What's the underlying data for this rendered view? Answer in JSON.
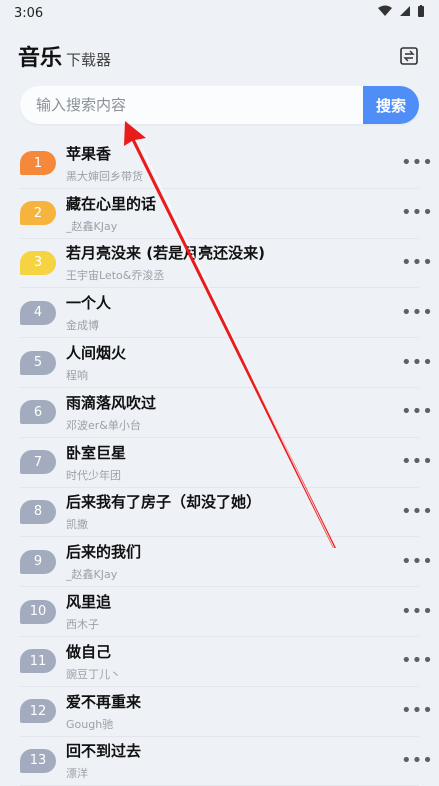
{
  "status": {
    "time": "3:06"
  },
  "header": {
    "title_main": "音乐",
    "title_sub": "下载器"
  },
  "search": {
    "placeholder": "输入搜索内容",
    "button_label": "搜索"
  },
  "songs": [
    {
      "rank": "1",
      "title": "苹果香",
      "artist": "黑大婶回乡带货",
      "badge_color": "#f6883c"
    },
    {
      "rank": "2",
      "title": "藏在心里的话",
      "artist": "_赵鑫KJay",
      "badge_color": "#f6b43f"
    },
    {
      "rank": "3",
      "title": "若月亮没来 (若是月亮还没来)",
      "artist": "王宇宙Leto&乔浚丞",
      "badge_color": "#f5d341"
    },
    {
      "rank": "4",
      "title": "一个人",
      "artist": "金成博",
      "badge_color": "#a2acbe"
    },
    {
      "rank": "5",
      "title": "人间烟火",
      "artist": "程响",
      "badge_color": "#a2acbe"
    },
    {
      "rank": "6",
      "title": "雨滴落风吹过",
      "artist": "邓波er&单小台",
      "badge_color": "#a2acbe"
    },
    {
      "rank": "7",
      "title": "卧室巨星",
      "artist": "时代少年团",
      "badge_color": "#a2acbe"
    },
    {
      "rank": "8",
      "title": "后来我有了房子（却没了她）",
      "artist": "凯撒",
      "badge_color": "#a2acbe"
    },
    {
      "rank": "9",
      "title": "后来的我们",
      "artist": "_赵鑫KJay",
      "badge_color": "#a2acbe"
    },
    {
      "rank": "10",
      "title": "风里追",
      "artist": "西木子",
      "badge_color": "#a2acbe"
    },
    {
      "rank": "11",
      "title": "做自己",
      "artist": "豌豆丁儿丶",
      "badge_color": "#a2acbe"
    },
    {
      "rank": "12",
      "title": "爱不再重来",
      "artist": "Gough驰",
      "badge_color": "#a2acbe"
    },
    {
      "rank": "13",
      "title": "回不到过去",
      "artist": "漂洋",
      "badge_color": "#a2acbe"
    }
  ],
  "icons": {
    "wifi": "wifi-icon",
    "signal": "signal-icon",
    "battery": "battery-icon",
    "switch": "swap-icon",
    "more": "more-icon",
    "annotation_arrow": "arrow-icon"
  }
}
